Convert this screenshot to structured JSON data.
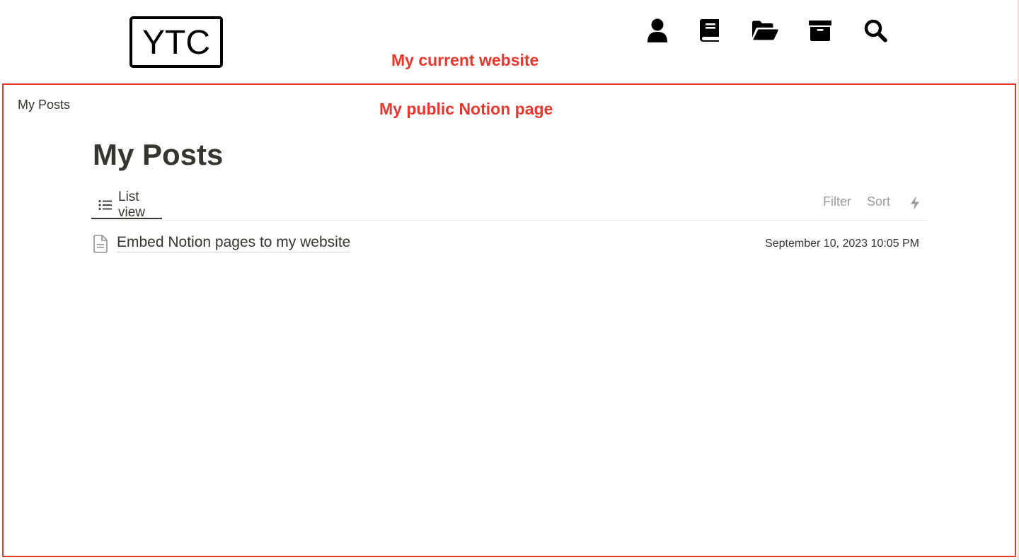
{
  "header": {
    "logo_text": "YTC",
    "icons": [
      "user-icon",
      "book-icon",
      "folder-open-icon",
      "archive-icon",
      "search-icon"
    ],
    "annotation": "My current website"
  },
  "notion": {
    "breadcrumb": "My Posts",
    "annotation": "My public Notion page",
    "title": "My Posts",
    "view_tab_label": "List view",
    "toolbar": {
      "filter_label": "Filter",
      "sort_label": "Sort",
      "automation_icon": "lightning-icon"
    },
    "rows": [
      {
        "title": "Embed Notion pages to my website",
        "date": "September 10, 2023 10:05 PM",
        "icon": "document-icon"
      }
    ]
  },
  "colors": {
    "annotation_red": "#e8382e",
    "notion_text": "#37352f",
    "muted_text": "#9b9a97"
  }
}
